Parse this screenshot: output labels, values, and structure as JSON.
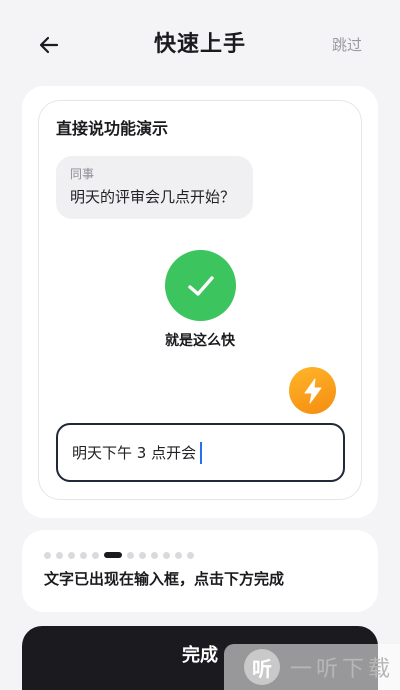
{
  "header": {
    "title": "快速上手",
    "skip_label": "跳过",
    "back_icon": "arrow-left-icon"
  },
  "demo": {
    "title": "直接说功能演示",
    "message": {
      "sender": "同事",
      "text": "明天的评审会几点开始？"
    },
    "success_caption": "就是这么快",
    "success_icon": "checkmark-icon",
    "flash_icon": "lightning-icon",
    "input_value": "明天下午 3 点开会"
  },
  "guide": {
    "current_step": 5,
    "total_steps": 12,
    "hint": "文字已出现在输入框，点击下方完成"
  },
  "footer": {
    "done_label": "完成"
  },
  "watermark": {
    "logo_glyph": "听",
    "text": "一听下载"
  },
  "colors": {
    "success": "#3cc45e",
    "flash": "#f7a21b",
    "caret": "#2a6ef2",
    "primary": "#1b1b1f"
  }
}
